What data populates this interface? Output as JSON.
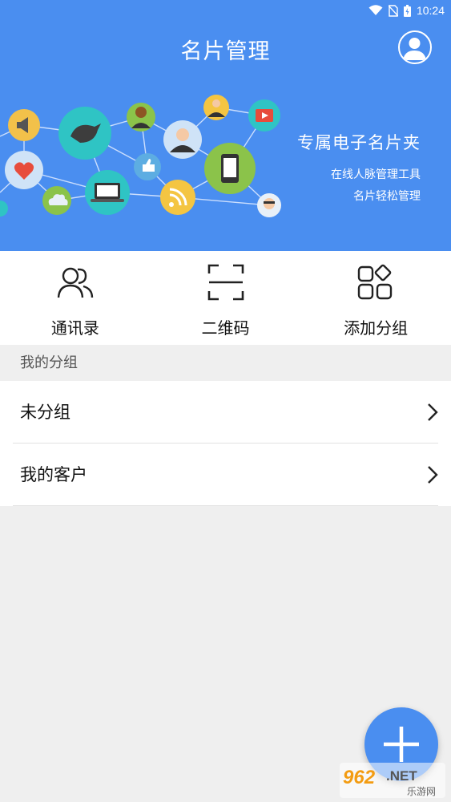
{
  "status_bar": {
    "time": "10:24"
  },
  "header": {
    "title": "名片管理"
  },
  "banner": {
    "title": "专属电子名片夹",
    "subtitle_1": "在线人脉管理工具",
    "subtitle_2": "名片轻松管理"
  },
  "quick_actions": [
    {
      "label": "通讯录",
      "icon": "contacts-icon"
    },
    {
      "label": "二维码",
      "icon": "qr-scan-icon"
    },
    {
      "label": "添加分组",
      "icon": "add-group-icon"
    }
  ],
  "groups": {
    "header": "我的分组",
    "items": [
      {
        "label": "未分组"
      },
      {
        "label": "我的客户"
      }
    ]
  },
  "watermark": {
    "brand": "962.NET",
    "caption": "乐游网"
  },
  "colors": {
    "primary": "#4a8ef0",
    "background": "#efefef",
    "surface": "#ffffff"
  }
}
